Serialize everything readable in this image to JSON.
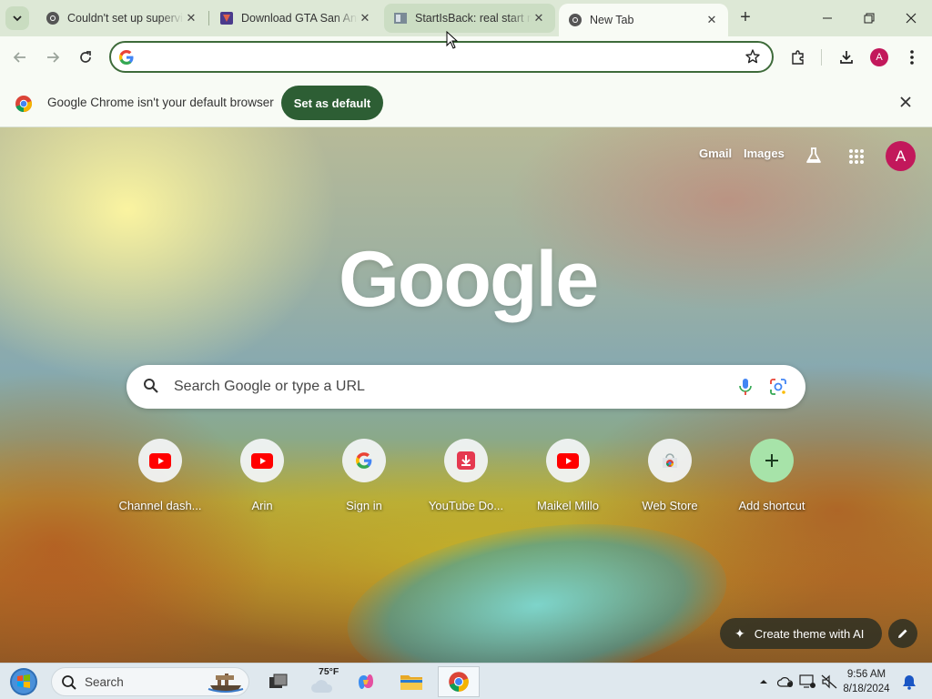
{
  "browser": {
    "tabs": [
      {
        "title": "Couldn't set up supervi",
        "favicon": "chrome-icon"
      },
      {
        "title": "Download GTA San Andre",
        "favicon": "gta-icon"
      },
      {
        "title": "StartIsBack: real start m",
        "favicon": "startisback-icon"
      },
      {
        "title": "New Tab",
        "favicon": "chrome-icon",
        "active": true
      }
    ],
    "omnibox": {
      "value": "",
      "placeholder": ""
    },
    "profile_initial": "A"
  },
  "infobar": {
    "message": "Google Chrome isn't your default browser",
    "button": "Set as default"
  },
  "ntp": {
    "links": {
      "gmail": "Gmail",
      "images": "Images"
    },
    "avatar": "A",
    "logo": "Google",
    "search_placeholder": "Search Google or type a URL",
    "shortcuts": [
      {
        "label": "Channel dash...",
        "icon": "youtube-icon"
      },
      {
        "label": "Arin",
        "icon": "youtube-icon"
      },
      {
        "label": "Sign in",
        "icon": "google-g-icon"
      },
      {
        "label": "YouTube Do...",
        "icon": "download-icon"
      },
      {
        "label": "Maikel Millo",
        "icon": "youtube-icon"
      },
      {
        "label": "Web Store",
        "icon": "webstore-icon"
      },
      {
        "label": "Add shortcut",
        "icon": "plus-icon"
      }
    ],
    "create_theme": "Create theme with AI"
  },
  "taskbar": {
    "search_label": "Search",
    "weather": "75°F",
    "time": "9:56 AM",
    "date": "8/18/2024"
  },
  "colors": {
    "accent": "#2d5e34",
    "profile": "#c2185b",
    "youtube_red": "#ff0000"
  }
}
